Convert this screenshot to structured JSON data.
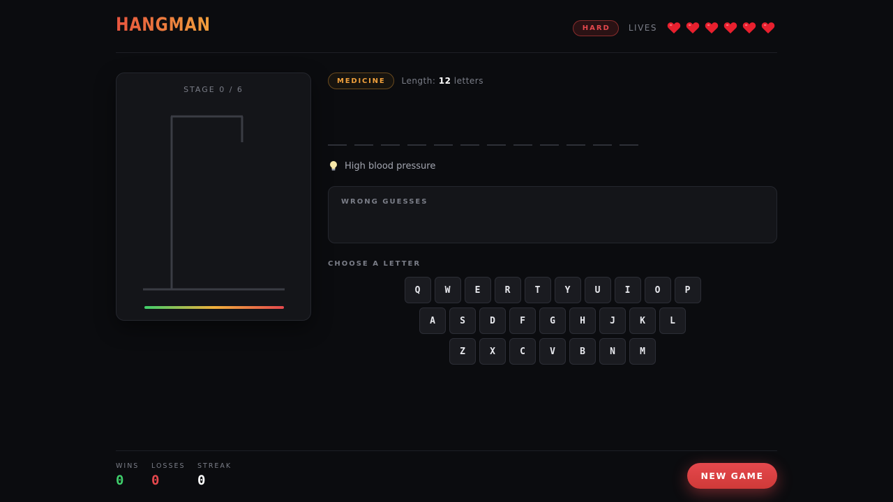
{
  "header": {
    "title": "HANGMAN",
    "difficulty": "HARD",
    "lives_label": "LIVES",
    "lives_total": 6,
    "lives_remaining": 6
  },
  "gallows": {
    "stage_label": "STAGE 0 / 6",
    "stage": 0,
    "max_stage": 6
  },
  "word": {
    "category": "MEDICINE",
    "length_prefix": "Length:",
    "length": "12",
    "length_suffix": "letters",
    "hint": "High blood pressure",
    "hint_icon": "lightbulb-icon"
  },
  "wrong_guesses": {
    "title": "WRONG GUESSES",
    "letters": []
  },
  "keyboard": {
    "title": "CHOOSE A LETTER",
    "rows": [
      [
        "Q",
        "W",
        "E",
        "R",
        "T",
        "Y",
        "U",
        "I",
        "O",
        "P"
      ],
      [
        "A",
        "S",
        "D",
        "F",
        "G",
        "H",
        "J",
        "K",
        "L"
      ],
      [
        "Z",
        "X",
        "C",
        "V",
        "B",
        "N",
        "M"
      ]
    ]
  },
  "stats": {
    "wins_label": "WINS",
    "wins": "0",
    "losses_label": "LOSSES",
    "losses": "0",
    "streak_label": "STREAK",
    "streak": "0"
  },
  "actions": {
    "new_game": "NEW GAME"
  },
  "colors": {
    "accent": "#e5484d",
    "brand_orange": "#f0a03c",
    "wins_green": "#3fcf6b",
    "losses_red": "#e5484d",
    "background": "#0b0c0f"
  }
}
